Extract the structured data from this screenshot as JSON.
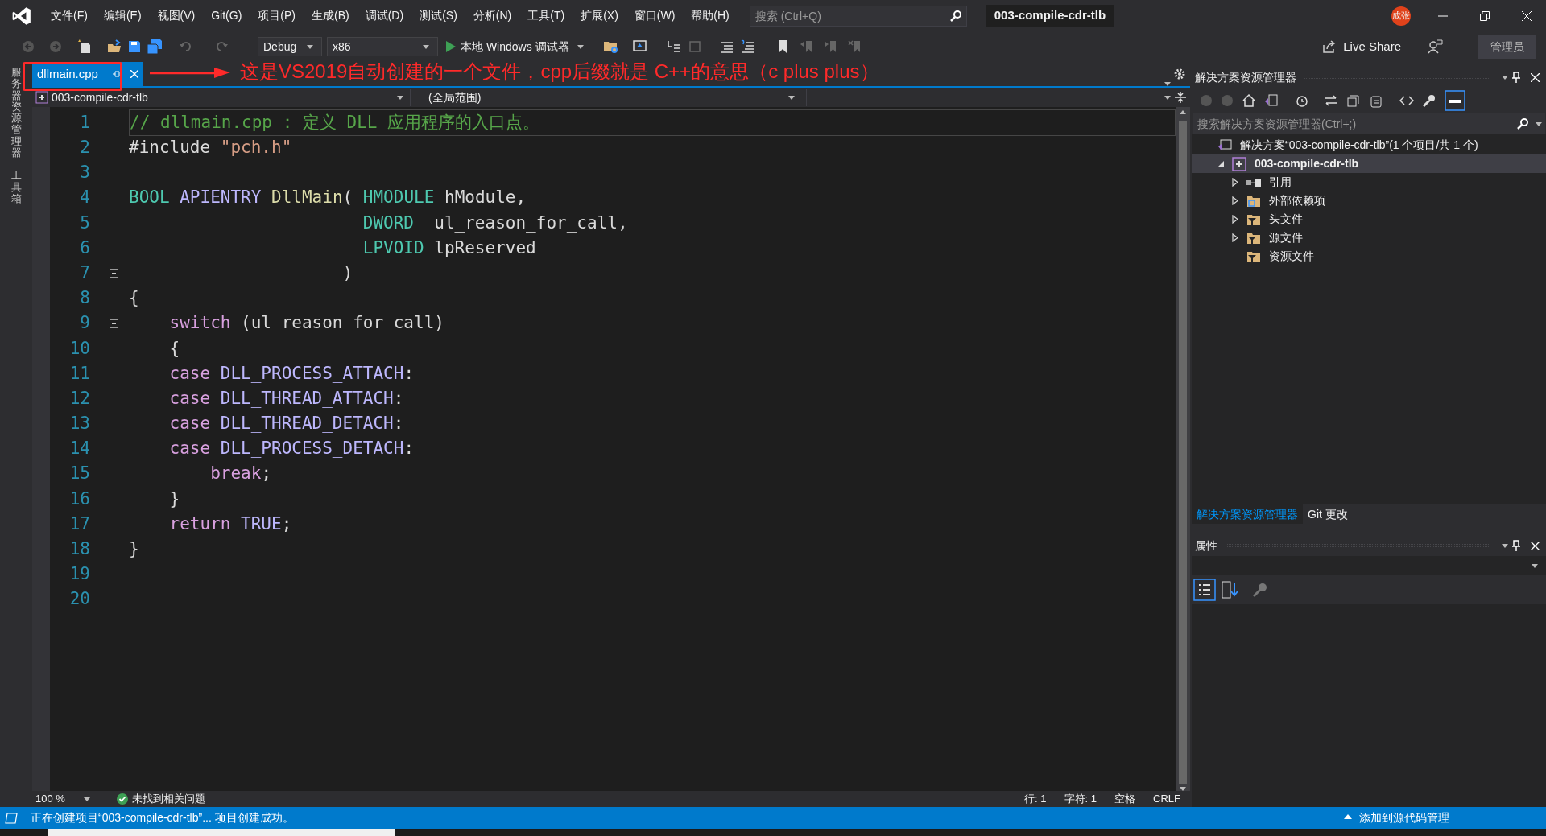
{
  "title_bar": {
    "menus": [
      "文件(F)",
      "编辑(E)",
      "视图(V)",
      "Git(G)",
      "项目(P)",
      "生成(B)",
      "调试(D)",
      "测试(S)",
      "分析(N)",
      "工具(T)",
      "扩展(X)",
      "窗口(W)",
      "帮助(H)"
    ],
    "search": {
      "placeholder": "搜索 (Ctrl+Q)"
    },
    "title": "003-compile-cdr-tlb",
    "avatar": "成张"
  },
  "toolbar": {
    "configuration": "Debug",
    "platform": "x86",
    "run_label": "本地 Windows 调试器",
    "live_share": "Live Share",
    "admin": "管理员"
  },
  "side_tabs": [
    "服务器资源管理器",
    "工具箱"
  ],
  "tabs": [
    {
      "label": "dllmain.cpp",
      "selected": true
    }
  ],
  "annotation": "这是VS2019自动创建的一个文件，cpp后缀就是 C++的意思（c plus plus）",
  "nav_bar": {
    "project": "003-compile-cdr-tlb",
    "scope": "(全局范围)"
  },
  "code": [
    {
      "number": "1",
      "tokens": [
        {
          "kind": "comment",
          "t": "// dllmain.cpp : 定义 DLL 应用程序的入口点。"
        }
      ]
    },
    {
      "number": "2",
      "tokens": [
        {
          "kind": "plain",
          "t": "#include "
        },
        {
          "kind": "string",
          "t": "\"pch.h\""
        }
      ]
    },
    {
      "number": "3"
    },
    {
      "number": "4",
      "tokens": [
        {
          "kind": "type",
          "t": "BOOL"
        },
        {
          "kind": "macro",
          "t": " APIENTRY"
        },
        {
          "kind": "func",
          "t": " DllMain"
        },
        {
          "kind": "plain",
          "t": "( "
        },
        {
          "kind": "type",
          "t": "HMODULE"
        },
        {
          "kind": "plain",
          "t": " hModule,"
        }
      ]
    },
    {
      "number": "5",
      "tokens": [
        {
          "kind": "type",
          "t": "                       DWORD"
        },
        {
          "kind": "plain",
          "t": "  ul_reason_for_call,"
        }
      ]
    },
    {
      "number": "6",
      "tokens": [
        {
          "kind": "type",
          "t": "                       LPVOID"
        },
        {
          "kind": "plain",
          "t": " lpReserved"
        }
      ]
    },
    {
      "number": "7",
      "fold": true,
      "tokens": [
        {
          "kind": "plain",
          "t": "                     )"
        }
      ]
    },
    {
      "number": "8",
      "tokens": [
        {
          "kind": "plain",
          "t": "{"
        }
      ]
    },
    {
      "number": "9",
      "fold": true,
      "tokens": [
        {
          "kind": "keyword",
          "t": "    switch"
        },
        {
          "kind": "plain",
          "t": " (ul_reason_for_call)"
        }
      ]
    },
    {
      "number": "10",
      "tokens": [
        {
          "kind": "plain",
          "t": "    {"
        }
      ]
    },
    {
      "number": "11",
      "tokens": [
        {
          "kind": "keyword",
          "t": "    case"
        },
        {
          "kind": "macro",
          "t": " DLL_PROCESS_ATTACH"
        },
        {
          "kind": "plain",
          "t": ":"
        }
      ]
    },
    {
      "number": "12",
      "tokens": [
        {
          "kind": "keyword",
          "t": "    case"
        },
        {
          "kind": "macro",
          "t": " DLL_THREAD_ATTACH"
        },
        {
          "kind": "plain",
          "t": ":"
        }
      ]
    },
    {
      "number": "13",
      "tokens": [
        {
          "kind": "keyword",
          "t": "    case"
        },
        {
          "kind": "macro",
          "t": " DLL_THREAD_DETACH"
        },
        {
          "kind": "plain",
          "t": ":"
        }
      ]
    },
    {
      "number": "14",
      "tokens": [
        {
          "kind": "keyword",
          "t": "    case"
        },
        {
          "kind": "macro",
          "t": " DLL_PROCESS_DETACH"
        },
        {
          "kind": "plain",
          "t": ":"
        }
      ]
    },
    {
      "number": "15",
      "tokens": [
        {
          "kind": "keyword",
          "t": "        break"
        },
        {
          "kind": "plain",
          "t": ";"
        }
      ]
    },
    {
      "number": "16",
      "tokens": [
        {
          "kind": "plain",
          "t": "    }"
        }
      ]
    },
    {
      "number": "17",
      "tokens": [
        {
          "kind": "keyword",
          "t": "    return"
        },
        {
          "kind": "macro",
          "t": " TRUE"
        },
        {
          "kind": "plain",
          "t": ";"
        }
      ]
    },
    {
      "number": "18",
      "tokens": [
        {
          "kind": "plain",
          "t": "}"
        }
      ]
    },
    {
      "number": "19"
    },
    {
      "number": "20"
    }
  ],
  "editor_status": {
    "zoom": "100 %",
    "issues": "未找到相关问题",
    "line": "行: 1",
    "char": "字符: 1",
    "indent": "空格",
    "eol": "CRLF"
  },
  "solution_explorer": {
    "title": "解决方案资源管理器",
    "search": {
      "placeholder": "搜索解决方案资源管理器(Ctrl+;)"
    },
    "tree": [
      {
        "label": "解决方案“003-compile-cdr-tlb”(1 个项目/共 1 个)",
        "kind": "solution",
        "children": [
          {
            "label": "003-compile-cdr-tlb",
            "kind": "project",
            "expanded": true,
            "selected": true,
            "children": [
              {
                "label": "引用",
                "kind": "reference",
                "expanded": false
              },
              {
                "label": "外部依赖项",
                "kind": "external",
                "expanded": false
              },
              {
                "label": "头文件",
                "kind": "filter",
                "expanded": false
              },
              {
                "label": "源文件",
                "kind": "filter",
                "expanded": false
              },
              {
                "label": "资源文件",
                "kind": "filter"
              }
            ]
          }
        ]
      }
    ],
    "tabs": [
      {
        "label": "解决方案资源管理器",
        "selected": true
      },
      {
        "label": "Git 更改",
        "selected": false
      }
    ]
  },
  "properties": {
    "title": "属性"
  },
  "status_bar": {
    "message": "正在创建项目“003-compile-cdr-tlb”... 项目创建成功。",
    "source_control": "添加到源代码管理"
  }
}
